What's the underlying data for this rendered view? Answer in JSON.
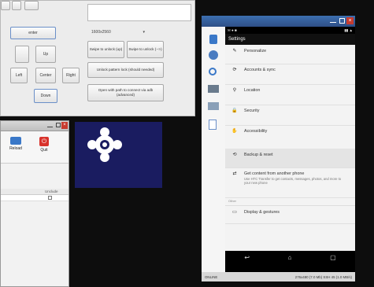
{
  "control": {
    "enter_label": "enter",
    "up_label": "Up",
    "left_label": "Left",
    "center_label": "Center",
    "right_label": "Right",
    "down_label": "Down",
    "device_value": "1600x2560",
    "swipe_up_label": "Swipe to unlock (up)",
    "swipe_lr_label": "Swipe to unlock (-->)",
    "pattern_label": "Unlock pattern lock (should needed)",
    "path_label": "Open with path to connect via adb (advanced)"
  },
  "window2": {
    "reload_label": "Reload",
    "quit_label": "Quit",
    "column_label": "Unclude"
  },
  "phone": {
    "appbar_title": "Settings",
    "items": [
      {
        "label": "Personalize",
        "icon": "personalize-icon"
      },
      {
        "label": "Accounts & sync",
        "icon": "sync-icon"
      },
      {
        "label": "Location",
        "icon": "location-icon"
      },
      {
        "label": "Security",
        "icon": "lock-icon"
      },
      {
        "label": "Accessibility",
        "icon": "hand-icon"
      },
      {
        "label": "Backup & reset",
        "icon": "backup-icon"
      },
      {
        "label": "Get content from another phone",
        "icon": "transfer-icon",
        "sub": "Use HTC Transfer to get contacts, messages, photos, and more to your new phone"
      },
      {
        "label": "Display & gestures",
        "icon": "display-icon"
      }
    ],
    "section_label": "Other",
    "status_left": "ONLINE",
    "status_right": "276x480 (7.0 Mb)  SSH 45 (1.0 MB/s)"
  },
  "colors": {
    "accent": "#1a1c60",
    "title_blue": "#2f4f86"
  }
}
